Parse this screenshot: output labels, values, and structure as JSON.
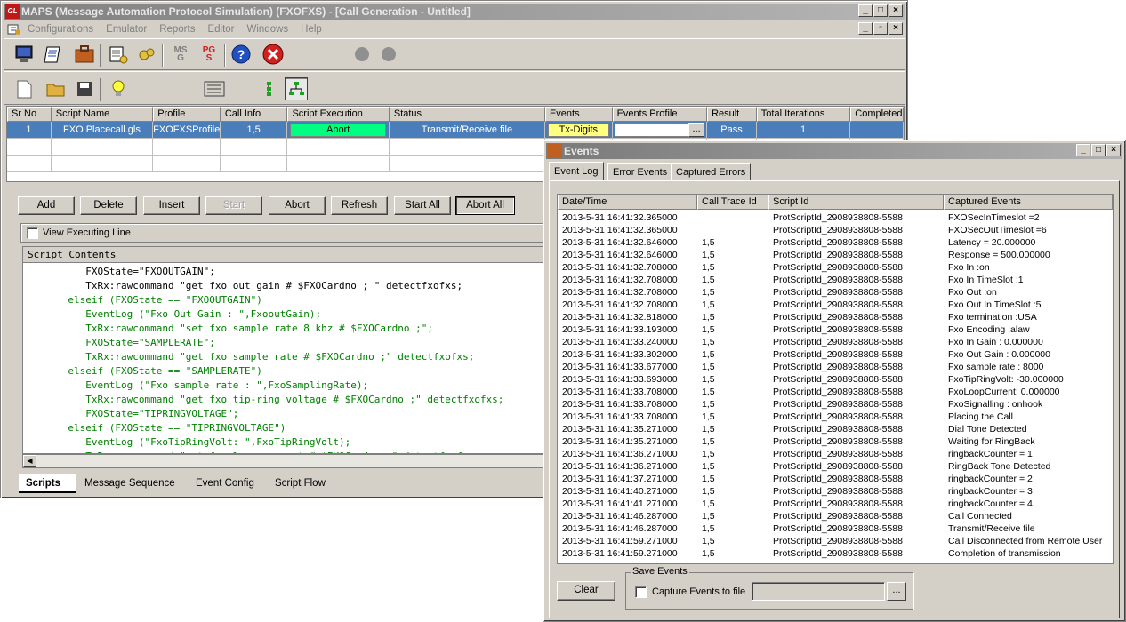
{
  "main_window": {
    "title": "MAPS (Message Automation Protocol Simulation) (FXOFXS) - [Call Generation - Untitled]",
    "app_icon_text": "GL",
    "menu": [
      "Configurations",
      "Emulator",
      "Reports",
      "Editor",
      "Windows",
      "Help"
    ],
    "toolbar_icons": [
      "monitor-icon",
      "notebook-icon",
      "briefcase-icon",
      "script-edit-icon",
      "gears-icon",
      "msg-icon",
      "pgs-icon",
      "help-icon",
      "stop-icon",
      "gray-dot-icon",
      "gray-dot-icon"
    ],
    "toolbar2_icons": [
      "new-file-icon",
      "open-folder-icon",
      "save-disk-icon",
      "lightbulb-icon",
      "list-view-icon",
      "tree-view-icon",
      "hierarchy-icon"
    ],
    "msg_label": "MS\nG",
    "pgs_label": "PG\nS"
  },
  "script_grid": {
    "columns": [
      "Sr No",
      "Script Name",
      "Profile",
      "Call Info",
      "Script Execution",
      "Status",
      "Events",
      "Events Profile",
      "Result",
      "Total Iterations",
      "Completed"
    ],
    "rows": [
      {
        "sr": "1",
        "script": "FXO Placecall.gls",
        "profile": "FXOFXSProfile",
        "call_info": "1,5",
        "execution": "Abort",
        "status": "Transmit/Receive file",
        "events": "Tx-Digits",
        "events_profile": "",
        "result": "Pass",
        "total": "1",
        "completed": ""
      }
    ]
  },
  "buttons": {
    "add": "Add",
    "delete": "Delete",
    "insert": "Insert",
    "start": "Start",
    "abort": "Abort",
    "refresh": "Refresh",
    "start_all": "Start All",
    "abort_all": "Abort All"
  },
  "view_executing_line": "View Executing Line",
  "script_contents_label": "Script Contents",
  "script_lines": [
    {
      "t": "          FXOState=\"FXOOUTGAIN\";",
      "c": "#000000"
    },
    {
      "t": "          TxRx:rawcommand \"get fxo out gain # $FXOCardno ; \" detectfxofxs;",
      "c": "#000000"
    },
    {
      "t": "       elseif (FXOState == \"FXOOUTGAIN\")",
      "c": "#008000"
    },
    {
      "t": "          EventLog (\"Fxo Out Gain : \",FxooutGain);",
      "c": "#008000"
    },
    {
      "t": "          TxRx:rawcommand \"set fxo sample rate 8 khz # $FXOCardno ;\";",
      "c": "#008000"
    },
    {
      "t": "          FXOState=\"SAMPLERATE\";",
      "c": "#008000"
    },
    {
      "t": "          TxRx:rawcommand \"get fxo sample rate # $FXOCardno ;\" detectfxofxs;",
      "c": "#008000"
    },
    {
      "t": "       elseif (FXOState == \"SAMPLERATE\")",
      "c": "#008000"
    },
    {
      "t": "          EventLog (\"Fxo sample rate : \",FxoSamplingRate);",
      "c": "#008000"
    },
    {
      "t": "          TxRx:rawcommand \"get fxo tip-ring voltage # $FXOCardno ;\" detectfxofxs;",
      "c": "#008000"
    },
    {
      "t": "          FXOState=\"TIPRINGVOLTAGE\";",
      "c": "#008000"
    },
    {
      "t": "       elseif (FXOState == \"TIPRINGVOLTAGE\")",
      "c": "#008000"
    },
    {
      "t": "          EventLog (\"FxoTipRingVolt: \",FxoTipRingVolt);",
      "c": "#008000"
    },
    {
      "t": "          TxRx:rawcommand \"get fxo loop current # $FXOCardno ;\" detectfxofxs;",
      "c": "#008000"
    }
  ],
  "bottom_tabs": [
    "Scripts",
    "Message Sequence",
    "Event Config",
    "Script Flow"
  ],
  "events_window": {
    "title": "Events",
    "tabs": [
      "Event Log",
      "Error Events",
      "Captured Errors"
    ],
    "columns": [
      "Date/Time",
      "Call Trace Id",
      "Script Id",
      "Captured Events"
    ],
    "rows": [
      [
        "2013-5-31 16:41:32.365000",
        "",
        "ProtScriptId_2908938808-5588",
        "FXOSecInTimeslot  =2"
      ],
      [
        "2013-5-31 16:41:32.365000",
        "",
        "ProtScriptId_2908938808-5588",
        "FXOSecOutTimeslot =6"
      ],
      [
        "2013-5-31 16:41:32.646000",
        "1,5",
        "ProtScriptId_2908938808-5588",
        "Latency = 20.000000"
      ],
      [
        "2013-5-31 16:41:32.646000",
        "1,5",
        "ProtScriptId_2908938808-5588",
        "Response = 500.000000"
      ],
      [
        "2013-5-31 16:41:32.708000",
        "1,5",
        "ProtScriptId_2908938808-5588",
        "Fxo In :on"
      ],
      [
        "2013-5-31 16:41:32.708000",
        "1,5",
        "ProtScriptId_2908938808-5588",
        "Fxo In TimeSlot :1"
      ],
      [
        "2013-5-31 16:41:32.708000",
        "1,5",
        "ProtScriptId_2908938808-5588",
        "Fxo Out :on"
      ],
      [
        "2013-5-31 16:41:32.708000",
        "1,5",
        "ProtScriptId_2908938808-5588",
        "Fxo Out In TimeSlot :5"
      ],
      [
        "2013-5-31 16:41:32.818000",
        "1,5",
        "ProtScriptId_2908938808-5588",
        "Fxo termination :USA"
      ],
      [
        "2013-5-31 16:41:33.193000",
        "1,5",
        "ProtScriptId_2908938808-5588",
        "Fxo Encoding :alaw"
      ],
      [
        "2013-5-31 16:41:33.240000",
        "1,5",
        "ProtScriptId_2908938808-5588",
        "Fxo In Gain : 0.000000"
      ],
      [
        "2013-5-31 16:41:33.302000",
        "1,5",
        "ProtScriptId_2908938808-5588",
        "Fxo Out Gain : 0.000000"
      ],
      [
        "2013-5-31 16:41:33.677000",
        "1,5",
        "ProtScriptId_2908938808-5588",
        "Fxo sample rate : 8000"
      ],
      [
        "2013-5-31 16:41:33.693000",
        "1,5",
        "ProtScriptId_2908938808-5588",
        "FxoTipRingVolt: -30.000000"
      ],
      [
        "2013-5-31 16:41:33.708000",
        "1,5",
        "ProtScriptId_2908938808-5588",
        "FxoLoopCurrent: 0.000000"
      ],
      [
        "2013-5-31 16:41:33.708000",
        "1,5",
        "ProtScriptId_2908938808-5588",
        "FxoSignalling : onhook"
      ],
      [
        "2013-5-31 16:41:33.708000",
        "1,5",
        "ProtScriptId_2908938808-5588",
        "Placing the Call"
      ],
      [
        "2013-5-31 16:41:35.271000",
        "1,5",
        "ProtScriptId_2908938808-5588",
        "Dial Tone Detected"
      ],
      [
        "2013-5-31 16:41:35.271000",
        "1,5",
        "ProtScriptId_2908938808-5588",
        "Waiting for RingBack"
      ],
      [
        "2013-5-31 16:41:36.271000",
        "1,5",
        "ProtScriptId_2908938808-5588",
        "ringbackCounter = 1"
      ],
      [
        "2013-5-31 16:41:36.271000",
        "1,5",
        "ProtScriptId_2908938808-5588",
        "RingBack Tone Detected"
      ],
      [
        "2013-5-31 16:41:37.271000",
        "1,5",
        "ProtScriptId_2908938808-5588",
        "ringbackCounter = 2"
      ],
      [
        "2013-5-31 16:41:40.271000",
        "1,5",
        "ProtScriptId_2908938808-5588",
        "ringbackCounter = 3"
      ],
      [
        "2013-5-31 16:41:41.271000",
        "1,5",
        "ProtScriptId_2908938808-5588",
        "ringbackCounter = 4"
      ],
      [
        "2013-5-31 16:41:46.287000",
        "1,5",
        "ProtScriptId_2908938808-5588",
        " Call Connected"
      ],
      [
        "2013-5-31 16:41:46.287000",
        "1,5",
        "ProtScriptId_2908938808-5588",
        "Transmit/Receive file"
      ],
      [
        "2013-5-31 16:41:59.271000",
        "1,5",
        "ProtScriptId_2908938808-5588",
        "Call Disconnected from Remote User"
      ],
      [
        "2013-5-31 16:41:59.271000",
        "1,5",
        "ProtScriptId_2908938808-5588",
        "Completion of transmission"
      ]
    ],
    "clear_label": "Clear",
    "save_events_label": "Save Events",
    "capture_label": "Capture Events to file",
    "browse_label": "...",
    "file_path": ""
  },
  "colors": {
    "selected_row": "#4a7ebb",
    "execution_cell": "#00ff80",
    "events_cell": "#ffff80"
  }
}
